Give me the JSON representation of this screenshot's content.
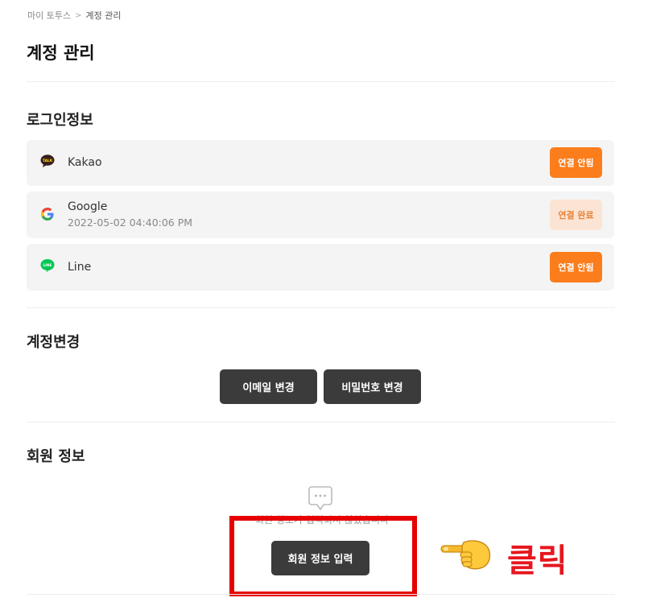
{
  "breadcrumb": {
    "parent": "마이 토투스",
    "separator": ">",
    "current": "계정 관리"
  },
  "page_title": "계정 관리",
  "login_section": {
    "title": "로그인정보",
    "providers": [
      {
        "name": "Kakao",
        "date": "",
        "status": "연결 안됨",
        "icon": "kakao-talk-icon"
      },
      {
        "name": "Google",
        "date": "2022-05-02 04:40:06 PM",
        "status": "연결 완료",
        "icon": "google-icon"
      },
      {
        "name": "Line",
        "date": "",
        "status": "연결 안됨",
        "icon": "line-icon"
      }
    ]
  },
  "account_section": {
    "title": "계정변경",
    "change_email_label": "이메일 변경",
    "change_password_label": "비밀번호 변경"
  },
  "member_section": {
    "title": "회원 정보",
    "empty_text": "회원 정보가 입력되지 않았습니다",
    "enter_info_label": "회원 정보 입력"
  },
  "annotation": {
    "click_label": "클릭",
    "pointer_icon": "pointing-hand-icon"
  },
  "colors": {
    "accent_orange": "#fb7d1c",
    "done_bg": "#fbe4d3",
    "dark_button": "#3b3b3b",
    "highlight_red": "#e60000"
  }
}
